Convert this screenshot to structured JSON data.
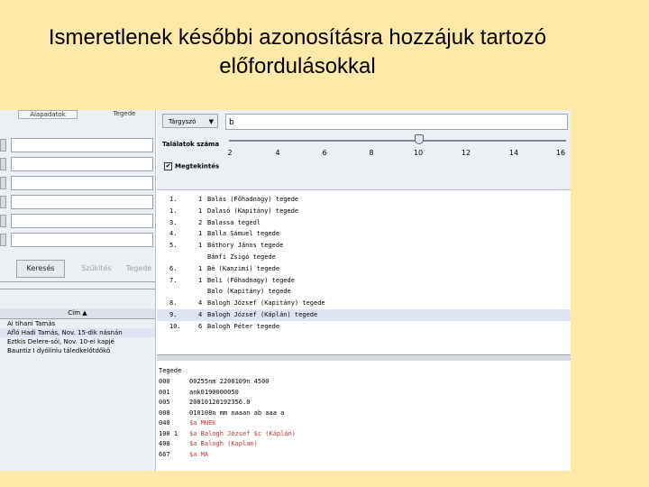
{
  "slide": {
    "title_line1": "Ismeretlenek későbbi azonosításra hozzájuk tartozó",
    "title_line2": "előfordulásokkal"
  },
  "left_panel": {
    "top_buttons": [
      "Alapadatok",
      "Tegede"
    ],
    "search_button": "Keresés",
    "clear_button": "Szűkítés",
    "other_button": "Tegede",
    "list_header": "Cím",
    "list_items": [
      "Ai tihani Tamás",
      "Afló Hadi Tamás, Nov. 15-dik násnán",
      "Eztkis Delere-sói, Nov. 10-ei kapjé",
      "Bauntiz I dyóliniu táledkelőtdőkö"
    ]
  },
  "search": {
    "dropdown_value": "Tárgyszó",
    "query_value": "b",
    "slider_label": "Találatok száma",
    "slider_level": 10,
    "ticks": [
      "2",
      "4",
      "6",
      "8",
      "10",
      "12",
      "14",
      "16"
    ],
    "checkbox_label": "Megtekintés",
    "checkbox_checked": true
  },
  "results": [
    {
      "n": "1.",
      "c": "1",
      "text": "Balás (Főhadnagy) tegede"
    },
    {
      "n": "1.",
      "c": "1",
      "text": "Dalasó (Kapitány) tegede"
    },
    {
      "n": "3.",
      "c": "2",
      "text": "Balassa tegedl"
    },
    {
      "n": "4.",
      "c": "1",
      "text": "Balla Sámuel tegede"
    },
    {
      "n": "5.",
      "c": "1",
      "text": "Báthory János tegede"
    },
    {
      "n": "",
      "c": "",
      "text": "Bánfi Zsigó tegede"
    },
    {
      "n": "6.",
      "c": "1",
      "text": "Bé (Kanzimi) tegede"
    },
    {
      "n": "7.",
      "c": "1",
      "text": "Beli (Főhadnagy) tegede"
    },
    {
      "n": "",
      "c": "",
      "text": "Balo (Kapitány) tegede"
    },
    {
      "n": "8.",
      "c": "4",
      "text": "Balogh József (Kapitány) tegede"
    },
    {
      "n": "9.",
      "c": "4",
      "text": "Balogh József (Káplán) tegede"
    },
    {
      "n": "10.",
      "c": "6",
      "text": "Balogh Péter tegede"
    }
  ],
  "record": {
    "title": "Tegede",
    "lines": [
      {
        "tag": "000",
        "text": "00255nm 2200109n 4500"
      },
      {
        "tag": "001",
        "text": "ank0190000050"
      },
      {
        "tag": "005",
        "text": "20010120192356.0"
      },
      {
        "tag": "008",
        "text": "010108n mm naaan ab aaa a"
      },
      {
        "tag": "040",
        "text": "$a MNEK"
      },
      {
        "tag": "100 1",
        "text": "$a Balogh József $c (Káplán)"
      },
      {
        "tag": "400",
        "text": "$a Balogh (Kaplan)"
      },
      {
        "tag": "667",
        "text": "$a MA"
      }
    ]
  },
  "colors": {
    "slide_background": "#ffe9a8",
    "selection": "#dfe4f5",
    "marc_subfield": "#b33a3a"
  }
}
